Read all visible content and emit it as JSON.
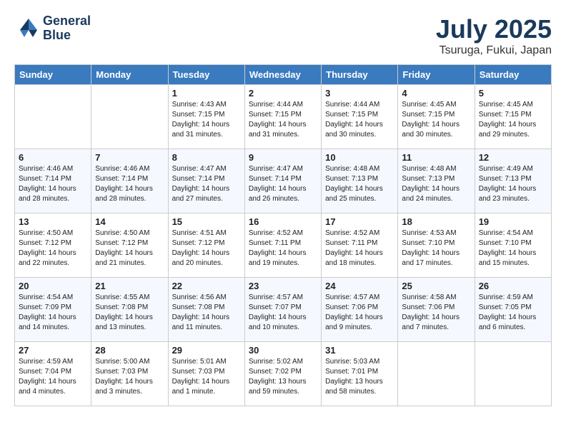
{
  "header": {
    "logo_line1": "General",
    "logo_line2": "Blue",
    "month": "July 2025",
    "location": "Tsuruga, Fukui, Japan"
  },
  "weekdays": [
    "Sunday",
    "Monday",
    "Tuesday",
    "Wednesday",
    "Thursday",
    "Friday",
    "Saturday"
  ],
  "weeks": [
    [
      {
        "day": "",
        "info": ""
      },
      {
        "day": "",
        "info": ""
      },
      {
        "day": "1",
        "info": "Sunrise: 4:43 AM\nSunset: 7:15 PM\nDaylight: 14 hours\nand 31 minutes."
      },
      {
        "day": "2",
        "info": "Sunrise: 4:44 AM\nSunset: 7:15 PM\nDaylight: 14 hours\nand 31 minutes."
      },
      {
        "day": "3",
        "info": "Sunrise: 4:44 AM\nSunset: 7:15 PM\nDaylight: 14 hours\nand 30 minutes."
      },
      {
        "day": "4",
        "info": "Sunrise: 4:45 AM\nSunset: 7:15 PM\nDaylight: 14 hours\nand 30 minutes."
      },
      {
        "day": "5",
        "info": "Sunrise: 4:45 AM\nSunset: 7:15 PM\nDaylight: 14 hours\nand 29 minutes."
      }
    ],
    [
      {
        "day": "6",
        "info": "Sunrise: 4:46 AM\nSunset: 7:14 PM\nDaylight: 14 hours\nand 28 minutes."
      },
      {
        "day": "7",
        "info": "Sunrise: 4:46 AM\nSunset: 7:14 PM\nDaylight: 14 hours\nand 28 minutes."
      },
      {
        "day": "8",
        "info": "Sunrise: 4:47 AM\nSunset: 7:14 PM\nDaylight: 14 hours\nand 27 minutes."
      },
      {
        "day": "9",
        "info": "Sunrise: 4:47 AM\nSunset: 7:14 PM\nDaylight: 14 hours\nand 26 minutes."
      },
      {
        "day": "10",
        "info": "Sunrise: 4:48 AM\nSunset: 7:13 PM\nDaylight: 14 hours\nand 25 minutes."
      },
      {
        "day": "11",
        "info": "Sunrise: 4:48 AM\nSunset: 7:13 PM\nDaylight: 14 hours\nand 24 minutes."
      },
      {
        "day": "12",
        "info": "Sunrise: 4:49 AM\nSunset: 7:13 PM\nDaylight: 14 hours\nand 23 minutes."
      }
    ],
    [
      {
        "day": "13",
        "info": "Sunrise: 4:50 AM\nSunset: 7:12 PM\nDaylight: 14 hours\nand 22 minutes."
      },
      {
        "day": "14",
        "info": "Sunrise: 4:50 AM\nSunset: 7:12 PM\nDaylight: 14 hours\nand 21 minutes."
      },
      {
        "day": "15",
        "info": "Sunrise: 4:51 AM\nSunset: 7:12 PM\nDaylight: 14 hours\nand 20 minutes."
      },
      {
        "day": "16",
        "info": "Sunrise: 4:52 AM\nSunset: 7:11 PM\nDaylight: 14 hours\nand 19 minutes."
      },
      {
        "day": "17",
        "info": "Sunrise: 4:52 AM\nSunset: 7:11 PM\nDaylight: 14 hours\nand 18 minutes."
      },
      {
        "day": "18",
        "info": "Sunrise: 4:53 AM\nSunset: 7:10 PM\nDaylight: 14 hours\nand 17 minutes."
      },
      {
        "day": "19",
        "info": "Sunrise: 4:54 AM\nSunset: 7:10 PM\nDaylight: 14 hours\nand 15 minutes."
      }
    ],
    [
      {
        "day": "20",
        "info": "Sunrise: 4:54 AM\nSunset: 7:09 PM\nDaylight: 14 hours\nand 14 minutes."
      },
      {
        "day": "21",
        "info": "Sunrise: 4:55 AM\nSunset: 7:08 PM\nDaylight: 14 hours\nand 13 minutes."
      },
      {
        "day": "22",
        "info": "Sunrise: 4:56 AM\nSunset: 7:08 PM\nDaylight: 14 hours\nand 11 minutes."
      },
      {
        "day": "23",
        "info": "Sunrise: 4:57 AM\nSunset: 7:07 PM\nDaylight: 14 hours\nand 10 minutes."
      },
      {
        "day": "24",
        "info": "Sunrise: 4:57 AM\nSunset: 7:06 PM\nDaylight: 14 hours\nand 9 minutes."
      },
      {
        "day": "25",
        "info": "Sunrise: 4:58 AM\nSunset: 7:06 PM\nDaylight: 14 hours\nand 7 minutes."
      },
      {
        "day": "26",
        "info": "Sunrise: 4:59 AM\nSunset: 7:05 PM\nDaylight: 14 hours\nand 6 minutes."
      }
    ],
    [
      {
        "day": "27",
        "info": "Sunrise: 4:59 AM\nSunset: 7:04 PM\nDaylight: 14 hours\nand 4 minutes."
      },
      {
        "day": "28",
        "info": "Sunrise: 5:00 AM\nSunset: 7:03 PM\nDaylight: 14 hours\nand 3 minutes."
      },
      {
        "day": "29",
        "info": "Sunrise: 5:01 AM\nSunset: 7:03 PM\nDaylight: 14 hours\nand 1 minute."
      },
      {
        "day": "30",
        "info": "Sunrise: 5:02 AM\nSunset: 7:02 PM\nDaylight: 13 hours\nand 59 minutes."
      },
      {
        "day": "31",
        "info": "Sunrise: 5:03 AM\nSunset: 7:01 PM\nDaylight: 13 hours\nand 58 minutes."
      },
      {
        "day": "",
        "info": ""
      },
      {
        "day": "",
        "info": ""
      }
    ]
  ]
}
